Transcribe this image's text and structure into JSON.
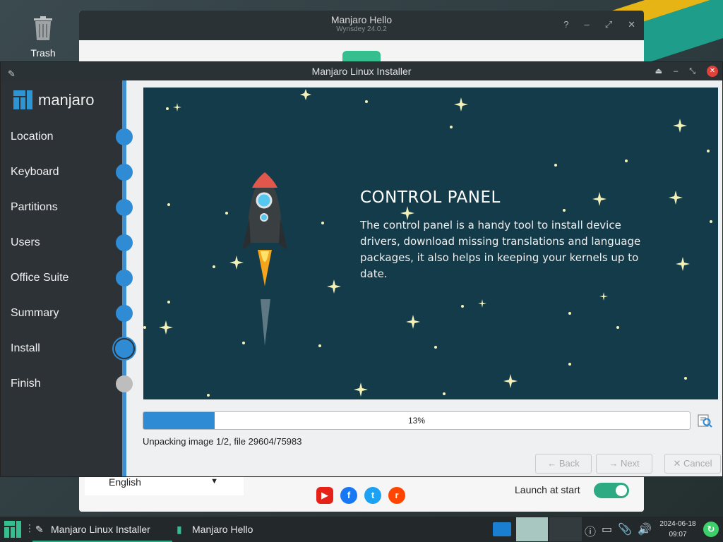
{
  "desktop": {
    "trash_label": "Trash"
  },
  "hello": {
    "title": "Manjaro Hello",
    "subtitle": "Wynsdey 24.0.2",
    "language": "English",
    "launch_label": "Launch at start",
    "launch_enabled": true,
    "socials": [
      "youtube-icon",
      "facebook-icon",
      "twitter-icon",
      "reddit-icon"
    ]
  },
  "installer": {
    "title": "Manjaro Linux Installer",
    "logo_text": "manjaro",
    "steps": [
      {
        "label": "Location",
        "state": "done"
      },
      {
        "label": "Keyboard",
        "state": "done"
      },
      {
        "label": "Partitions",
        "state": "done"
      },
      {
        "label": "Users",
        "state": "done"
      },
      {
        "label": "Office Suite",
        "state": "done"
      },
      {
        "label": "Summary",
        "state": "done"
      },
      {
        "label": "Install",
        "state": "current"
      },
      {
        "label": "Finish",
        "state": "pending"
      }
    ],
    "slide": {
      "title": "CONTROL PANEL",
      "body": "The control panel is a handy tool to install device drivers, download missing translations and language packages, it also helps in keeping your kernels up to date."
    },
    "progress": {
      "value": 0.13,
      "text": "13%"
    },
    "status": "Unpacking image 1/2, file 29604/75983",
    "buttons": {
      "back": "Back",
      "next": "Next",
      "cancel": "Cancel"
    }
  },
  "taskbar": {
    "tasks": [
      "Manjaro Linux Installer",
      "Manjaro Hello"
    ],
    "date": "2024-06-18",
    "time": "09:07"
  },
  "colors": {
    "accent": "#2e8bd4",
    "slide_bg": "#143b49",
    "toggle_on": "#2eaa83"
  }
}
